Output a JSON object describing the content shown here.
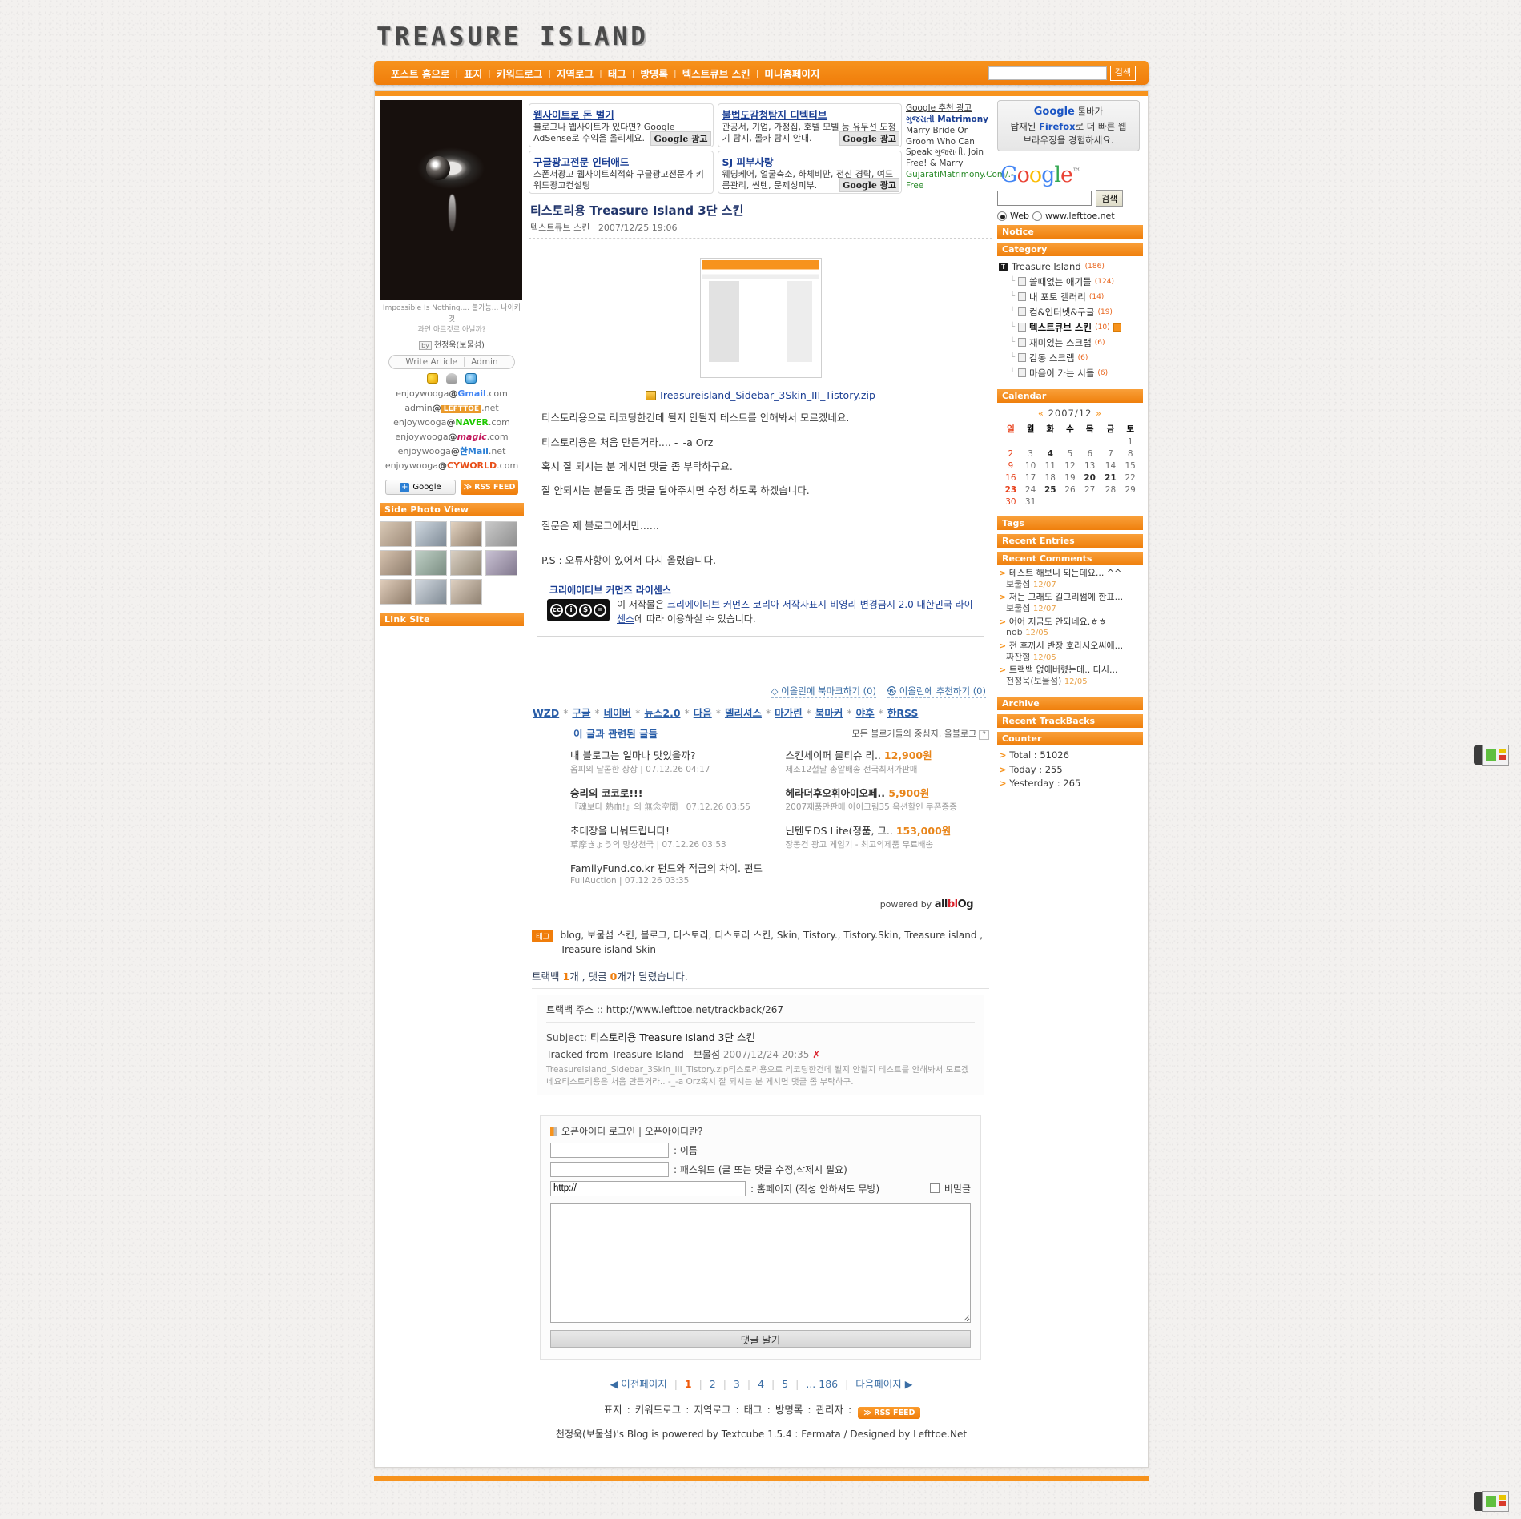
{
  "header": {
    "site_title": "TREASURE ISLAND",
    "nav": [
      "포스트 홈으로",
      "표지",
      "키워드로그",
      "지역로그",
      "태그",
      "방명록",
      "텍스트큐브 스킨",
      "미니홈페이지"
    ],
    "search_value": "",
    "search_button": "검색"
  },
  "ads": {
    "items": [
      {
        "title": "웹사이트로 돈 벌기",
        "body": "블로그나 웹사이트가 있다면? Google AdSense로 수익을 올리세요.",
        "badge": "Google 광고"
      },
      {
        "title": "불법도감청탐지 디텍티브",
        "body": "관공서, 기업, 가정집, 호텔 모텔 등 유무선 도청기 탐지, 몰카 탐지 안내.",
        "badge": "Google 광고"
      },
      {
        "title": "구글광고전문 인터애드",
        "body": "스폰서광고 웹사이트최적화 구글광고전문가 키워드광고컨설팅",
        "badge": ""
      },
      {
        "title": "SJ 피부사랑",
        "body": "웨딩케어, 얼굴축소, 하체비만, 전신 경락, 여드름관리, 썬텐, 문제성피부.",
        "badge": "Google 광고"
      }
    ],
    "recommend": {
      "heading": "Google 추천 광고",
      "link": "ગુજરાતી Matrimony",
      "body": "Marry Bride Or Groom Who Can Speak ગુજરાતી. Join Free! & Marry",
      "url": "GujaratiMatrimony.Com/.-Free"
    }
  },
  "google_box": {
    "promo_line1_a": "Google",
    "promo_line1_b": "툴바가",
    "promo_line2_a": "탑재된",
    "promo_line2_b": "Firefox",
    "promo_line2_c": "로 더 빠른 웹",
    "promo_line3": "브라우징을 경험하세요.",
    "logo": "Google",
    "search_value": "",
    "search_button": "검색",
    "radio_web": "Web",
    "radio_site": "www.lefttoe.net"
  },
  "left_sidebar": {
    "tagline_line1": "Impossible Is Nothing....  불가능... 나이키것",
    "tagline_line2": "과연 아르것르 아닐까?",
    "by_label": "by",
    "author": "천정욱(보물섬)",
    "write_article": "Write Article",
    "admin": "Admin",
    "emails": [
      {
        "user": "enjoywooga",
        "domain": "Gmail",
        "tld": ".com",
        "style": "gmail"
      },
      {
        "user": "admin",
        "domain": "LEFTTOE",
        "tld": ".net",
        "style": "lefttoe"
      },
      {
        "user": "enjoywooga",
        "domain": "NAVER",
        "tld": ".com",
        "style": "naver"
      },
      {
        "user": "enjoywooga",
        "domain": "magic",
        "tld": ".com",
        "style": "magic"
      },
      {
        "user": "enjoywooga",
        "domain": "한Mail",
        "tld": ".net",
        "style": "hanmail"
      },
      {
        "user": "enjoywooga",
        "domain": "CYWORLD",
        "tld": ".com",
        "style": "cyworld"
      }
    ],
    "google_btn": "Google",
    "rss_btn": "RSS FEED",
    "side_photo_view": "Side Photo View",
    "link_site": "Link Site",
    "thumb_count": 11
  },
  "post": {
    "title": "티스토리용 Treasure Island 3단 스킨",
    "category": "텍스트큐브 스킨",
    "date": "2007/12/25 19:06",
    "attachment": "Treasureisland_Sidebar_3Skin_III_Tistory.zip",
    "paragraphs": [
      "티스토리용으로 리코딩한건데 될지 안될지 테스트를 안해봐서 모르겠네요.",
      "티스토리용은 처음 만든거라.... -_-a Orz",
      "혹시 잘 되시는 분 게시면 댓글 좀 부탁하구요.",
      "잘 안되시는 분들도 좀 댓글 달아주시면 수정 하도록 하겠습니다.",
      "질문은 제 블로그에서만......",
      "P.S : 오류사항이 있어서 다시 올렸습니다."
    ]
  },
  "cc": {
    "legend": "크리에이티브 커먼즈 라이센스",
    "text_before": "이 저작물은 ",
    "license_link": "크리에이티브 커먼즈 코리아 저작자표시-비영리-변경금지 2.0 대한민국 라이센스",
    "text_after": "에 따라 이용하실 수 있습니다.",
    "badge_by": "BY",
    "badge_nc": "NC",
    "badge_nd": "ND"
  },
  "bookmark": {
    "allim_bookmark": "◇ 이올린에 북마크하기 (0)",
    "allim_recommend": "㉿ 이올린에 추천하기 (0)"
  },
  "sns": [
    "WZD",
    "구글",
    "네이버",
    "뉴스2.0",
    "다음",
    "델리셔스",
    "마가린",
    "북마커",
    "야후",
    "한RSS"
  ],
  "related": {
    "heading": "이 글과 관련된 글들",
    "right_heading": "모든 블로거들의 중심지, 올블로그",
    "left_items": [
      {
        "title": "내 블로그는 얼마나 맛있을까?",
        "bold": false,
        "sub": "옴피의 달콤한 상상 | 07.12.26 04:17"
      },
      {
        "title": "승리의 코코로!!!",
        "bold": true,
        "sub": "『魂보다 熱血!』의 無念空間 | 07.12.26 03:55"
      },
      {
        "title": "초대장을 나눠드립니다!",
        "bold": false,
        "sub": "草摩きょう의 망상천국 | 07.12.26 03:53"
      },
      {
        "title": "FamilyFund.co.kr 펀드와 적금의 차이. 펀드",
        "bold": false,
        "sub": "FullAuction | 07.12.26 03:35"
      }
    ],
    "right_items": [
      {
        "title": "스킨세이퍼 물티슈 리..",
        "price": "12,900원",
        "bold": false,
        "sub": "제조12철달 총알배송 전국최저가판매"
      },
      {
        "title": "헤라더후오휘아이오페..",
        "price": "5,900원",
        "bold": true,
        "sub": "2007제품만판매 아이크림35 옥션할인 쿠폰증증"
      },
      {
        "title": "닌텐도DS Lite(정품, 그..",
        "price": "153,000원",
        "bold": false,
        "sub": "장동건 광고 게임기 - 최고의제품 무료배송"
      }
    ],
    "powered_by": "powered by",
    "powered_brand": "allblog"
  },
  "tags": {
    "badge": "태그",
    "list": "blog, 보물섬 스킨, 블로그, 티스토리, 티스토리 스킨, Skin, Tistory., Tistory.Skin, Treasure island , Treasure island Skin"
  },
  "counts": {
    "prefix": "트랙백 ",
    "trackbacks": "1",
    "mid": "개 , 댓글 ",
    "comments": "0",
    "suffix": "개가 달렸습니다."
  },
  "trackback": {
    "address_label": "트랙백 주소 :: ",
    "address": "http://www.lefttoe.net/trackback/267",
    "subject_label": "Subject: ",
    "subject": "티스토리용 Treasure Island 3단 스킨",
    "from": "Tracked from Treasure Island - 보물섬",
    "date": "2007/12/24 20:35",
    "delete": "✗",
    "excerpt": "Treasureisland_Sidebar_3Skin_III_Tistory.zip티스토리용으로 리코딩한건데 될지 안될지 테스트를 안해봐서 모르겠네요티스토리용은 처음 만든거라.. -_-a Orz혹시 잘 되시는 분 게시면 댓글 좀 부탁하구."
  },
  "comment_form": {
    "openid_login": "오픈아이디 로그인",
    "openid_what": "오픈아이디란?",
    "separator": "|",
    "name_value": "",
    "name_label": ": 이름",
    "password_value": "",
    "password_label": ": 패스워드 (글 또는 댓글 수정,삭제시 필요)",
    "homepage_value": "http://",
    "homepage_label": ": 홈페이지 (작성 안하셔도 무방)",
    "secret_label": "비밀글",
    "body_value": "",
    "submit": "댓글 달기"
  },
  "right_sidebar": {
    "notice": "Notice",
    "category": "Category",
    "category_root": {
      "label": "Treasure Island",
      "count": "(186)",
      "icon": "T"
    },
    "category_items": [
      {
        "label": "쓸때없는 애기들",
        "count": "(124)",
        "bold": false,
        "new": false
      },
      {
        "label": "내 포토 겔러리",
        "count": "(14)",
        "bold": false,
        "new": false
      },
      {
        "label": "컴&인터넷&구글",
        "count": "(19)",
        "bold": false,
        "new": false
      },
      {
        "label": "텍스트큐브 스킨",
        "count": "(10)",
        "bold": true,
        "new": true
      },
      {
        "label": "재미있는 스크랩",
        "count": "(6)",
        "bold": false,
        "new": false
      },
      {
        "label": "감동 스크랩",
        "count": "(6)",
        "bold": false,
        "new": false
      },
      {
        "label": "마음이 가는 시들",
        "count": "(6)",
        "bold": false,
        "new": false
      }
    ],
    "calendar_title": "Calendar",
    "calendar_month": "2007/12",
    "calendar_prev": "«",
    "calendar_next": "»",
    "weekdays": [
      "일",
      "월",
      "화",
      "수",
      "목",
      "금",
      "토"
    ],
    "calendar_weeks": [
      [
        {
          "d": ""
        },
        {
          "d": ""
        },
        {
          "d": ""
        },
        {
          "d": ""
        },
        {
          "d": ""
        },
        {
          "d": ""
        },
        {
          "d": "1",
          "sat": true
        }
      ],
      [
        {
          "d": "2",
          "sun": true
        },
        {
          "d": "3"
        },
        {
          "d": "4",
          "has": true
        },
        {
          "d": "5"
        },
        {
          "d": "6"
        },
        {
          "d": "7"
        },
        {
          "d": "8",
          "sat": true
        }
      ],
      [
        {
          "d": "9",
          "sun": true
        },
        {
          "d": "10"
        },
        {
          "d": "11"
        },
        {
          "d": "12"
        },
        {
          "d": "13"
        },
        {
          "d": "14"
        },
        {
          "d": "15",
          "sat": true
        }
      ],
      [
        {
          "d": "16",
          "sun": true
        },
        {
          "d": "17"
        },
        {
          "d": "18"
        },
        {
          "d": "19"
        },
        {
          "d": "20",
          "has": true
        },
        {
          "d": "21",
          "has": true
        },
        {
          "d": "22",
          "sat": true
        }
      ],
      [
        {
          "d": "23",
          "today": true
        },
        {
          "d": "24"
        },
        {
          "d": "25",
          "has": true
        },
        {
          "d": "26"
        },
        {
          "d": "27"
        },
        {
          "d": "28"
        },
        {
          "d": "29",
          "sat": true
        }
      ],
      [
        {
          "d": "30",
          "sun": true
        },
        {
          "d": "31"
        },
        {
          "d": ""
        },
        {
          "d": ""
        },
        {
          "d": ""
        },
        {
          "d": ""
        },
        {
          "d": ""
        }
      ]
    ],
    "tags": "Tags",
    "recent_entries": "Recent Entries",
    "recent_comments": "Recent Comments",
    "comments": [
      {
        "text": "테스트 해보니 되는데요... ^^",
        "author": "보물섬",
        "date": "12/07"
      },
      {
        "text": "저는 그래도 길그리썸에 한표...",
        "author": "보물섬",
        "date": "12/07"
      },
      {
        "text": "어어 지금도 안되네요.ㅎㅎ",
        "author": "nob",
        "date": "12/05"
      },
      {
        "text": "전 후까시 반장 호라시오씨에...",
        "author": "짜잔형",
        "date": "12/05"
      },
      {
        "text": "트랙백 없애버렸는데.. 다시...",
        "author": "천정욱(보물섬)",
        "date": "12/05"
      }
    ],
    "archive": "Archive",
    "recent_trackbacks": "Recent TrackBacks",
    "counter": "Counter",
    "counter_items": [
      "Total : 51026",
      "Today : 255",
      "Yesterday : 265"
    ]
  },
  "footer": {
    "prev_page": "◀ 이전페이지",
    "pages": [
      "1",
      "2",
      "3",
      "4",
      "5"
    ],
    "current": "1",
    "ellipsis": "... 186",
    "next_page": "다음페이지 ▶",
    "links": [
      "표지",
      "키워드로그",
      "지역로그",
      "태그",
      "방명록",
      "관리자"
    ],
    "rss": "RSS FEED",
    "credit": "천정욱(보물섬)'s Blog is powered by Textcube 1.5.4 : Fermata / Designed by Lefttoe.Net"
  }
}
